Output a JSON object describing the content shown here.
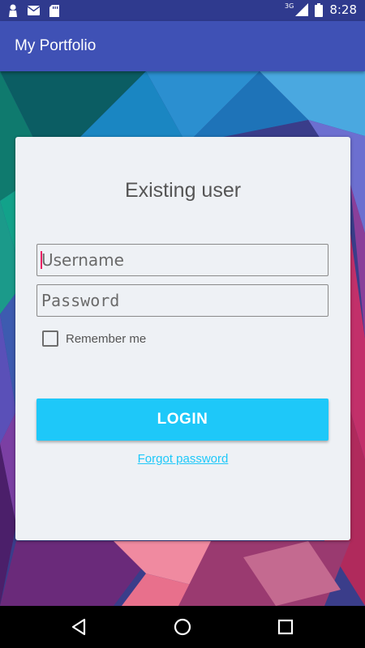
{
  "status_bar": {
    "network": "3G",
    "time": "8:28",
    "icons": [
      "person-icon",
      "mail-icon",
      "sd-card-icon",
      "signal-icon",
      "battery-icon"
    ]
  },
  "app_bar": {
    "title": "My Portfolio",
    "color": "#3f51b5"
  },
  "login_card": {
    "title": "Existing user",
    "username": {
      "value": "",
      "placeholder": "Username"
    },
    "password": {
      "value": "",
      "placeholder": "Password"
    },
    "remember_me": {
      "label": "Remember me",
      "checked": false
    },
    "login_button": "LOGIN",
    "forgot_password": "Forgot password",
    "accent_color": "#1ec8f9"
  },
  "nav_bar": {
    "icons": [
      "back-icon",
      "home-icon",
      "recents-icon"
    ]
  }
}
